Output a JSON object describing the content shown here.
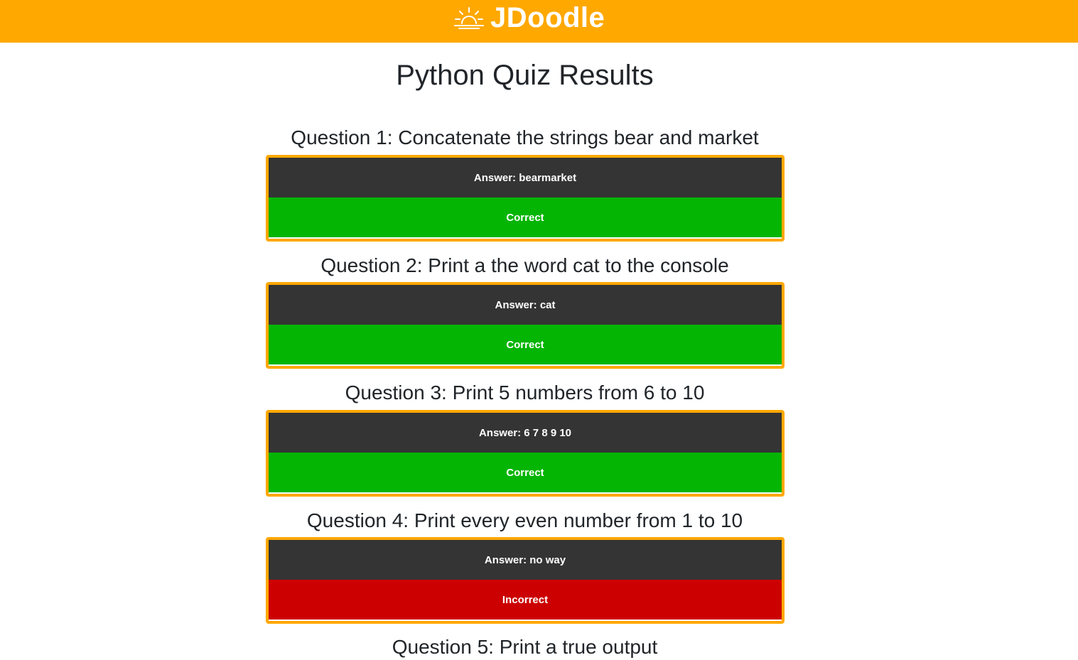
{
  "header": {
    "brand": "JDoodle",
    "logo_icon": "sunrise-icon",
    "background": "#ffa800"
  },
  "page": {
    "title": "Python Quiz Results"
  },
  "questions": [
    {
      "title": "Question 1: Concatenate the strings bear and market",
      "answer": "Answer: bearmarket",
      "result": "Correct"
    },
    {
      "title": "Question 2: Print a the word cat to the console",
      "answer": "Answer: cat",
      "result": "Correct"
    },
    {
      "title": "Question 3: Print 5 numbers from 6 to 10",
      "answer": "Answer: 6 7 8 9 10",
      "result": "Correct"
    },
    {
      "title": "Question 4: Print every even number from 1 to 10",
      "answer": "Answer: no way",
      "result": "Incorrect"
    },
    {
      "title": "Question 5: Print a true output"
    }
  ],
  "colors": {
    "accent": "#ffa800",
    "answer_bg": "#343434",
    "correct": "#04b504",
    "incorrect": "#cc0000"
  }
}
